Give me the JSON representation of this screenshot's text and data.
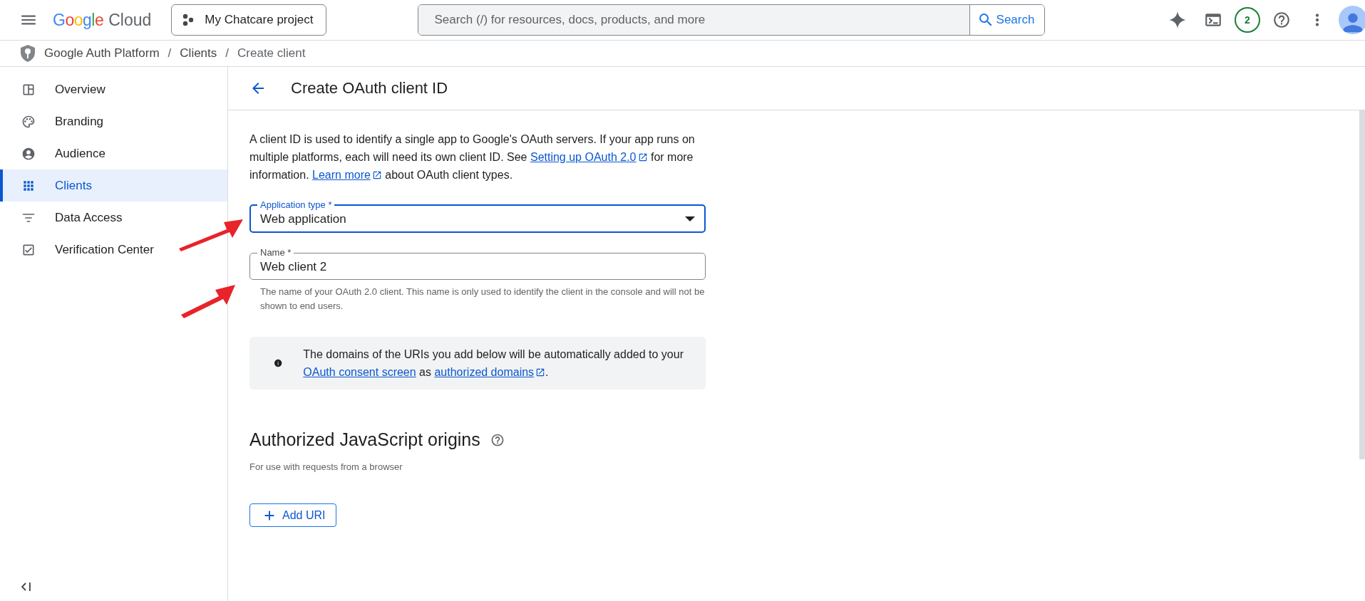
{
  "topbar": {
    "logo": {
      "brand": "Google",
      "product": "Cloud"
    },
    "project": "My Chatcare project",
    "search": {
      "placeholder": "Search (/) for resources, docs, products, and more",
      "button": "Search"
    },
    "notifications": "2"
  },
  "breadcrumb": [
    "Google Auth Platform",
    "Clients",
    "Create client"
  ],
  "breadcrumb_separator": "/",
  "sidebar": {
    "items": [
      {
        "label": "Overview",
        "selected": false
      },
      {
        "label": "Branding",
        "selected": false
      },
      {
        "label": "Audience",
        "selected": false
      },
      {
        "label": "Clients",
        "selected": true
      },
      {
        "label": "Data Access",
        "selected": false
      },
      {
        "label": "Verification Center",
        "selected": false
      }
    ]
  },
  "page": {
    "title": "Create OAuth client ID",
    "intro": [
      {
        "kind": "text",
        "text": "A client ID is used to identify a single app to Google's OAuth servers. If your app runs on multiple platforms, each will need its own client ID. See "
      },
      {
        "kind": "external",
        "text": "Setting up OAuth 2.0"
      },
      {
        "kind": "text",
        "text": " for more information. "
      },
      {
        "kind": "external",
        "text": "Learn more"
      },
      {
        "kind": "text",
        "text": " about OAuth client types."
      }
    ],
    "fields": [
      {
        "kind": "select",
        "label": "Application type *",
        "value": "Web application",
        "focused": true
      },
      {
        "kind": "text",
        "label": "Name *",
        "value": "Web client 2",
        "focused": false,
        "helper": "The name of your OAuth 2.0 client. This name is only used to identify the client in the console and will not be shown to end users."
      }
    ],
    "notice": [
      {
        "kind": "text",
        "text": "The domains of the URIs you add below will be automatically added to your "
      },
      {
        "kind": "link",
        "text": "OAuth consent screen"
      },
      {
        "kind": "text",
        "text": " as "
      },
      {
        "kind": "external",
        "text": "authorized domains"
      },
      {
        "kind": "text",
        "text": "."
      }
    ],
    "section": {
      "title": "Authorized JavaScript origins",
      "subtitle": "For use with requests from a browser",
      "button": "Add URI"
    }
  }
}
